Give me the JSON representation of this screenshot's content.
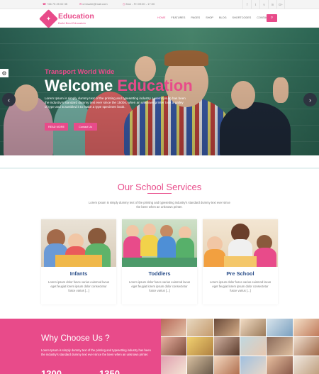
{
  "topbar": {
    "phone": "+66 75 25 02 35",
    "email": "cmrsuite@mail.com",
    "hours": "Mon - Fri 09:00 - 17:00",
    "social_icons": [
      "facebook-icon",
      "twitter-icon",
      "vimeo-icon",
      "linkedin-icon",
      "google-plus-icon"
    ],
    "social_glyphs": [
      "f",
      "t",
      "v",
      "in",
      "G+"
    ]
  },
  "header": {
    "logo_title": "Education",
    "logo_sub": "Build Best Educatoin",
    "nav": [
      "HOME",
      "FEATURES",
      "PAGES",
      "SHOP",
      "BLOG",
      "SHORTCODES",
      "CONTACT US"
    ],
    "active_nav": "HOME",
    "search_glyph": "⌕"
  },
  "hero": {
    "kicker": "Transport World Wide",
    "title_white": "Welcome ",
    "title_pink": "Education",
    "desc": "Lorem Ipsum is simply dummy text of the printing and typesetting industry. Lorem Ipsum has been the industry's standard dummy text ever since the 1500s, when an unknown printer took a galley of type and scrambled it to make a type specimen book.",
    "btn_read": "READ MORE",
    "btn_contact": "Contact Us",
    "prev": "‹",
    "next": "›",
    "settings_glyph": "⚙"
  },
  "services": {
    "title": "Our School Services",
    "desc": "Lorem Ipsum is simply dummy text of the printing and typesetting industry's standard dummy text ever since the been when an unknown printer.",
    "cards": [
      {
        "title": "Infants",
        "desc": "Lorem ipsum dolor fusce varius euismod lacus eget feugiat lorem ipsum dolor consectetur fusce varius [...]"
      },
      {
        "title": "Toddlers",
        "desc": "Lorem ipsum dolor fusce varius euismod lacus eget feugiat lorem ipsum dolor consectetur fusce varius [...]"
      },
      {
        "title": "Pre School",
        "desc": "Lorem ipsum dolor fusce varius euismod lacus eget feugiat lorem ipsum dolor consectetur fusce varius [...]"
      }
    ]
  },
  "why": {
    "title": "Why Choose Us ?",
    "desc": "Lorem Ipsum is simply dummy text of the printing and typesetting industry has been the industry's standard dummy text ever since the been when an unknown printer.",
    "stat1": "1200",
    "stat2": "1350"
  },
  "colors": {
    "accent": "#e84b8a",
    "title_blue": "#2b4f8a"
  }
}
